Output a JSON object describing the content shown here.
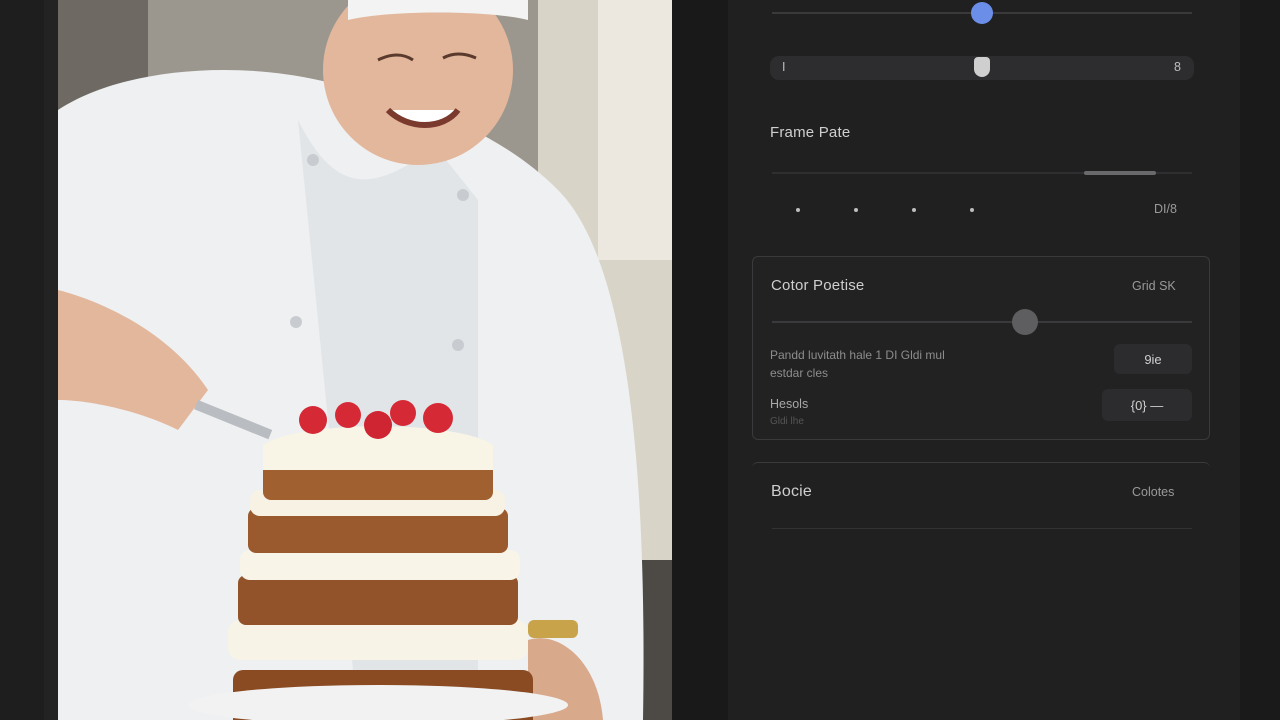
{
  "panel": {
    "range": {
      "min_label": "I",
      "max_label": "8"
    },
    "frame_rate": {
      "title": "Frame Pate",
      "value_label": "DI/8"
    },
    "color_section": {
      "title": "Cotor Poetise",
      "action_label": "Grid SK",
      "desc_line1": "Pandd luvitath hale 1 DI Gldi mul",
      "desc_line2": "estdar cles",
      "value_pill": "9ie",
      "resols_label": "Hesols",
      "resols_sub": "Gldi lhe",
      "stepper_value": "{0} —"
    },
    "bottom_section": {
      "title": "Bocie",
      "action_label": "Colotes"
    }
  },
  "colors": {
    "accent": "#6b8ee8",
    "panel_bg": "#202021",
    "knob_grey": "#5e5e60"
  }
}
